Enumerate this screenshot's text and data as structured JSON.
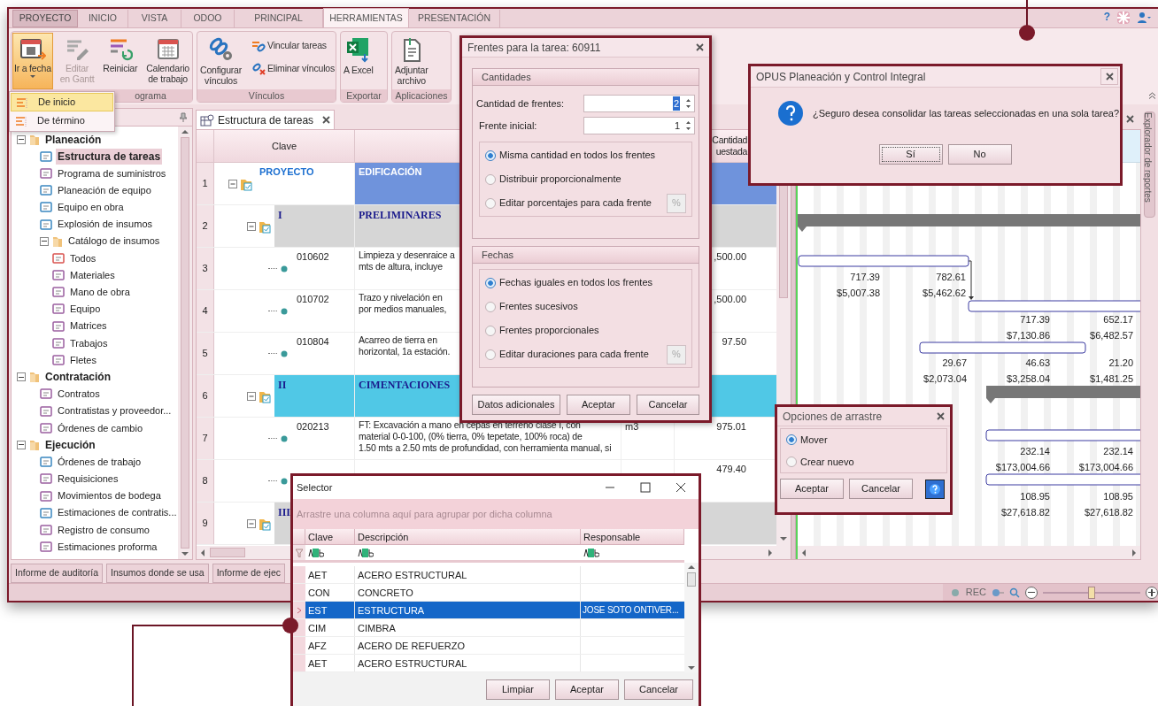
{
  "app": {
    "tabs": [
      {
        "label": "PROYECTO",
        "kind": "file",
        "selected": false
      },
      {
        "label": "INICIO",
        "kind": "tab",
        "selected": false
      },
      {
        "label": "VISTA",
        "kind": "tab",
        "selected": false
      },
      {
        "label": "ODOO",
        "kind": "tab",
        "selected": false
      },
      {
        "label": "PRINCIPAL",
        "kind": "tab",
        "selected": false
      },
      {
        "label": "HERRAMIENTAS",
        "kind": "tab",
        "selected": true
      },
      {
        "label": "PRESENTACIÓN",
        "kind": "tab",
        "selected": false
      }
    ],
    "help": "?",
    "ribbon": [
      {
        "label": "ograma",
        "buttons": [
          {
            "label": "Ir a fecha",
            "pressed": true,
            "disabled": false
          },
          {
            "label": "Editar\nen Gantt",
            "pressed": false,
            "disabled": true
          },
          {
            "label": "Reiniciar",
            "pressed": false,
            "disabled": false
          },
          {
            "label": "Calendario\nde trabajo",
            "pressed": false,
            "disabled": false
          }
        ]
      },
      {
        "label": "Vínculos",
        "buttons": [
          {
            "label": "Configurar\nvínculos",
            "pressed": false,
            "disabled": false
          }
        ],
        "small_buttons": [
          "Vincular tareas",
          "Eliminar vínculos"
        ]
      },
      {
        "label": "Exportar",
        "buttons": [
          {
            "label": "A Excel",
            "pressed": false,
            "disabled": false
          }
        ]
      },
      {
        "label": "Aplicaciones",
        "buttons": [
          {
            "label": "Adjuntar\narchivo",
            "pressed": false,
            "disabled": false
          }
        ]
      }
    ],
    "menu": [
      {
        "label": "De inicio",
        "selected": true
      },
      {
        "label": "De término",
        "selected": false
      }
    ],
    "tree": [
      {
        "label": "Planeación",
        "expanded": true,
        "children": [
          {
            "label": "Estructura de tareas",
            "selected": true
          },
          {
            "label": "Programa de suministros",
            "selected": false
          },
          {
            "label": "Planeación de equipo",
            "selected": false
          },
          {
            "label": "Equipo en obra",
            "selected": false
          },
          {
            "label": "Explosión de insumos",
            "selected": false
          },
          {
            "label": "Catálogo de insumos",
            "selected": false,
            "expanded": true,
            "children": [
              {
                "label": "Todos",
                "selected": false
              },
              {
                "label": "Materiales",
                "selected": false
              },
              {
                "label": "Mano de obra",
                "selected": false
              },
              {
                "label": "Equipo",
                "selected": false
              },
              {
                "label": "Matrices",
                "selected": false
              },
              {
                "label": "Trabajos",
                "selected": false
              },
              {
                "label": "Fletes",
                "selected": false
              }
            ]
          }
        ]
      },
      {
        "label": "Contratación",
        "expanded": true,
        "children": [
          {
            "label": "Contratos",
            "selected": false
          },
          {
            "label": "Contratistas y proveedor...",
            "selected": false
          },
          {
            "label": "Órdenes de cambio",
            "selected": false
          }
        ]
      },
      {
        "label": "Ejecución",
        "expanded": true,
        "children": [
          {
            "label": "Órdenes de trabajo",
            "selected": false
          },
          {
            "label": "Requisiciones",
            "selected": false
          },
          {
            "label": "Movimientos de bodega",
            "selected": false
          },
          {
            "label": "Estimaciones de contratis...",
            "selected": false
          },
          {
            "label": "Registro de consumo",
            "selected": false
          },
          {
            "label": "Estimaciones proforma",
            "selected": false
          }
        ]
      }
    ],
    "document_tab": "Estructura de tareas",
    "table": {
      "columns": [
        "Clave",
        "Cantidad\nuestada"
      ],
      "rows": [
        {
          "num": "1",
          "kind": "project",
          "clave": "PROYECTO",
          "descripcion": "EDIFICACIÓN",
          "color": "#6f93dc",
          "children": [
            {
              "num": "2",
              "kind": "group",
              "clave": "I",
              "descripcion": "PRELIMINARES",
              "color": "#d6d6d6",
              "children": [
                {
                  "num": "3",
                  "kind": "task",
                  "clave": "010602",
                  "descripcion": "Limpieza y desenraice a\nmts de altura, incluye",
                  "cantidad": ",500.00"
                },
                {
                  "num": "4",
                  "kind": "task",
                  "clave": "010702",
                  "descripcion": "Trazo y nivelación en\npor medios manuales,",
                  "cantidad": ",500.00"
                },
                {
                  "num": "5",
                  "kind": "task",
                  "clave": "010804",
                  "descripcion": "Acarreo de tierra en\nhorizontal, 1a estación.",
                  "cantidad": "97.50"
                }
              ]
            },
            {
              "num": "6",
              "kind": "group",
              "clave": "II",
              "descripcion": "CIMENTACIONES",
              "color": "#50c8e6",
              "children": [
                {
                  "num": "7",
                  "kind": "task",
                  "clave": "020213",
                  "descripcion": "FT: Excavación a mano en cepas en terreno clase I, con\nmaterial 0-0-100, (0% tierra, 0% tepetate, 100% roca) de\n1.50 mts a 2.50 mts de profundidad, con herramienta manual, si",
                  "unidad": "m3",
                  "cantidad": "975.01"
                },
                {
                  "num": "8",
                  "kind": "task",
                  "cantidad": "479.40"
                }
              ]
            },
            {
              "num": "9",
              "kind": "group",
              "clave": "III",
              "color": "#d6d6d6"
            }
          ]
        }
      ]
    },
    "gantt_labels": [
      {
        "qty": "717.39",
        "cost": "$5,007.38"
      },
      {
        "qty": "782.61",
        "cost": "$5,462.62"
      },
      {
        "qty": "717.39",
        "cost": "$7,130.86"
      },
      {
        "qty": "652.17",
        "cost": "$6,482.57"
      },
      {
        "qty": "29.67",
        "cost": "$2,073.04"
      },
      {
        "qty": "46.63",
        "cost": "$3,258.04"
      },
      {
        "qty": "21.20",
        "cost": "$1,481.25"
      },
      {
        "qty": "232.14",
        "cost": "$173,004.66"
      },
      {
        "qty": "232.14",
        "cost": "$173,004.66"
      },
      {
        "qty": "108.95",
        "cost": "$27,618.82"
      },
      {
        "qty": "108.95",
        "cost": "$27,618.82"
      }
    ],
    "side_tab": "Explorador de reportes",
    "bottom_tabs": [
      "Informe de auditoría",
      "Insumos donde se usa",
      "Informe de ejec"
    ],
    "status": {
      "rec": "REC",
      "zoom": {
        "level": 0.5
      }
    }
  },
  "frentes_dialog": {
    "title": "Frentes para la tarea: 60911",
    "cantidades": {
      "title": "Cantidades",
      "fields": [
        {
          "label": "Cantidad de frentes:",
          "value": "2"
        },
        {
          "label": "Frente inicial:",
          "value": "1"
        }
      ],
      "options": [
        {
          "label": "Misma cantidad en todos los frentes",
          "selected": true
        },
        {
          "label": "Distribuir proporcionalmente",
          "selected": false
        },
        {
          "label": "Editar porcentajes para cada frente",
          "selected": false,
          "button": "%"
        }
      ]
    },
    "fechas": {
      "title": "Fechas",
      "options": [
        {
          "label": "Fechas iguales en todos los frentes",
          "selected": true
        },
        {
          "label": "Frentes sucesivos",
          "selected": false
        },
        {
          "label": "Frentes proporcionales",
          "selected": false
        },
        {
          "label": "Editar duraciones para cada frente",
          "selected": false,
          "button": "%"
        }
      ]
    },
    "buttons": [
      "Datos adicionales",
      "Aceptar",
      "Cancelar"
    ]
  },
  "confirm_dialog": {
    "title": "OPUS Planeación y Control Integral",
    "message": "¿Seguro desea consolidar las tareas seleccionadas en una sola tarea?",
    "buttons": [
      "Sí",
      "No"
    ]
  },
  "drag_dialog": {
    "title": "Opciones de arrastre",
    "options": [
      {
        "label": "Mover",
        "selected": true
      },
      {
        "label": "Crear nuevo",
        "selected": false
      }
    ],
    "buttons": [
      "Aceptar",
      "Cancelar"
    ]
  },
  "selector": {
    "title": "Selector",
    "group_hint": "Arrastre una columna aquí para agrupar por dicha columna",
    "columns": [
      "Clave",
      "Descripción",
      "Responsable"
    ],
    "rows": [
      {
        "clave": "AET",
        "descripcion": "ACERO ESTRUCTURAL",
        "selected": false
      },
      {
        "clave": "CON",
        "descripcion": "CONCRETO",
        "selected": false
      },
      {
        "clave": "EST",
        "descripcion": "ESTRUCTURA",
        "responsable": "JOSE SOTO ONTIVER...",
        "selected": true
      },
      {
        "clave": "CIM",
        "descripcion": "CIMBRA",
        "selected": false
      },
      {
        "clave": "AFZ",
        "descripcion": "ACERO DE REFUERZO",
        "selected": false
      },
      {
        "clave": "AET",
        "descripcion": "ACERO ESTRUCTURAL",
        "selected": false
      }
    ],
    "buttons": [
      "Limpiar",
      "Aceptar",
      "Cancelar"
    ]
  }
}
